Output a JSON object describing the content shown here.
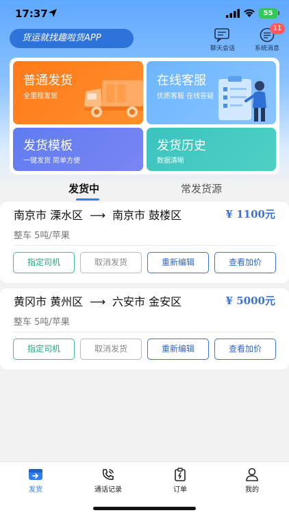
{
  "status_bar": {
    "time": "17:37",
    "battery": "55"
  },
  "header": {
    "slogan": "货运就找趣啦货APP",
    "chat_label": "聊天会话",
    "messages_label": "系统消息",
    "messages_badge": "11"
  },
  "tiles": [
    {
      "title": "普通发货",
      "subtitle": "全里程发货"
    },
    {
      "title": "在线客服",
      "subtitle": "优质客服 在线答疑"
    },
    {
      "title": "发货模板",
      "subtitle": "一键发货 简单方便"
    },
    {
      "title": "发货历史",
      "subtitle": "数据清晰"
    }
  ],
  "tabs": {
    "active": "发货中",
    "inactive": "常发货源"
  },
  "orders": [
    {
      "from": "南京市 溧水区",
      "to": "南京市 鼓楼区",
      "arrow": "⟶",
      "price": "¥ 1100元",
      "spec": "整车 5吨/苹果",
      "buttons": [
        "指定司机",
        "取消发货",
        "重新编辑",
        "查看加价"
      ]
    },
    {
      "from": "黄冈市 黄州区",
      "to": "六安市 金安区",
      "arrow": "⟶",
      "price": "¥ 5000元",
      "spec": "整车 5吨/苹果",
      "buttons": [
        "指定司机",
        "取消发货",
        "重新编辑",
        "查看加价"
      ]
    }
  ],
  "bottom_nav": [
    {
      "label": "发货",
      "icon": "shipping-box-icon",
      "active": true
    },
    {
      "label": "通话记录",
      "icon": "phone-call-icon",
      "active": false
    },
    {
      "label": "订单",
      "icon": "order-clipboard-icon",
      "active": false
    },
    {
      "label": "我的",
      "icon": "profile-icon",
      "active": false
    }
  ],
  "colors": {
    "accent_blue": "#2f7ff0",
    "price_blue": "#3a72d8",
    "tile_orange": "#ff7a1a",
    "tile_blue": "#6cb6ff",
    "tile_purple": "#5f7cf0",
    "tile_teal": "#3cc3bf",
    "green_button": "#3dbf96",
    "badge_red": "#ff5a5f"
  }
}
